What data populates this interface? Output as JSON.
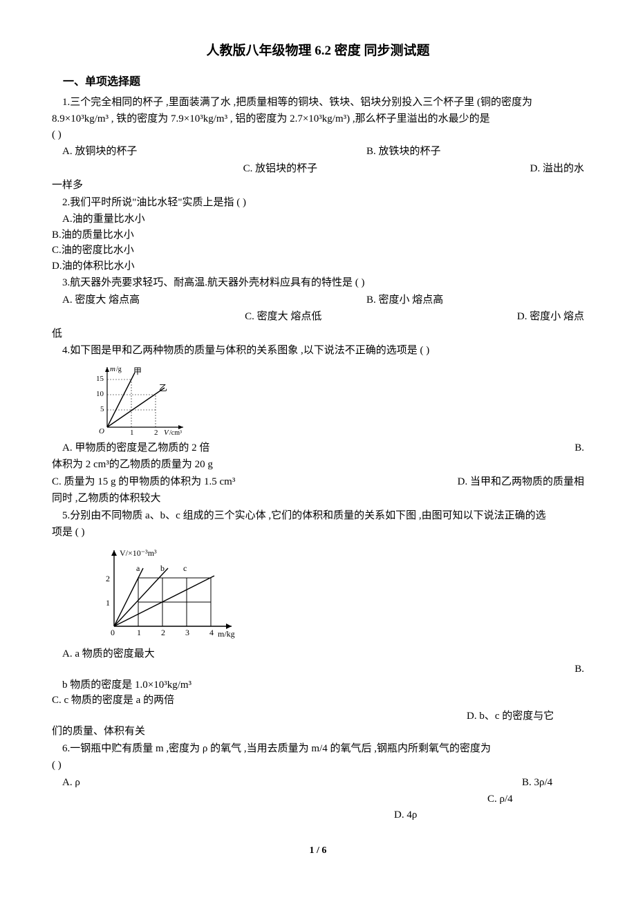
{
  "title": "人教版八年级物理 6.2 密度 同步测试题",
  "section1": "一、单项选择题",
  "q1": {
    "text": "1.三个完全相同的杯子 ,里面装满了水 ,把质量相等的铜块、铁块、铝块分别投入三个杯子里 (铜的密度为",
    "text2": "8.9×10³kg/m³   , 铁的密度为 7.9×10³kg/m³   , 铝的密度为 2.7×10³kg/m³)  ,那么杯子里溢出的水最少的是",
    "text3": "(     )",
    "a": "A.  放铜块的杯子",
    "b": "B.  放铁块的杯子",
    "c": "C.  放铝块的杯子",
    "d": "D.  溢出的水",
    "dext": "一样多"
  },
  "q2": {
    "text": "2.我们平时所说\"油比水轻\"实质上是指 (      )",
    "a": "A.油的重量比水小",
    "b": "B.油的质量比水小",
    "c": "C.油的密度比水小",
    "d": "D.油的体积比水小"
  },
  "q3": {
    "text": "3.航天器外壳要求轻巧、耐高温.航天器外壳材料应具有的特性是 (     )",
    "a": "A.  密度大   熔点高",
    "b": "B.  密度小   熔点高",
    "c": "C.  密度大   熔点低",
    "d": "D.  密度小   熔点",
    "dext": "低"
  },
  "q4": {
    "text": "4.如下图是甲和乙两种物质的质量与体积的关系图象 ,以下说法不正确的选项是 (       )",
    "a": "A.  甲物质的密度是乙物质的 2 倍",
    "b": "B.",
    "bext": "体积为 2 cm³的乙物质的质量为 20 g",
    "c": "C.  质量为 15 g 的甲物质的体积为 1.5 cm³",
    "d": "D.  当甲和乙两物质的质量相",
    "dext": "同时 ,乙物质的体积较大"
  },
  "q5": {
    "text": "5.分别由不同物质 a、b、c 组成的三个实心体 ,它们的体积和质量的关系如下图 ,由图可知以下说法正确的选",
    "text2": "项是 (    )",
    "a": "A.  a 物质的密度最大",
    "b": "B.",
    "bext": "b 物质的密度是 1.0×10³kg/m³",
    "c": "C.  c 物质的密度是 a 的两倍",
    "d": "D.  b、c 的密度与它",
    "dext": "们的质量、体积有关"
  },
  "q6": {
    "text": "6.一钢瓶中贮有质量 m ,密度为 ρ 的氧气 ,当用去质量为 m/4 的氧气后 ,钢瓶内所剩氧气的密度为",
    "text2": "(        )",
    "a": "A.   ρ",
    "b": "B.  3ρ/4",
    "c": "C.   ρ/4",
    "d": "D.  4ρ"
  },
  "footer": "1 / 6",
  "chart_data": [
    {
      "type": "line",
      "title": "Q4 质量-体积图象",
      "xlabel": "V/cm³",
      "ylabel": "m/g",
      "xlim": [
        0,
        2.2
      ],
      "ylim": [
        0,
        17
      ],
      "yticks": [
        5,
        10,
        15
      ],
      "xticks": [
        1,
        2
      ],
      "series": [
        {
          "name": "甲",
          "x": [
            0,
            1
          ],
          "y": [
            0,
            15
          ]
        },
        {
          "name": "乙",
          "x": [
            0,
            2
          ],
          "y": [
            0,
            10
          ]
        }
      ]
    },
    {
      "type": "line",
      "title": "Q5 体积-质量图象",
      "xlabel": "m/kg",
      "ylabel": "V/×10⁻³m³",
      "xlim": [
        0,
        4.2
      ],
      "ylim": [
        0,
        2.5
      ],
      "yticks": [
        1,
        2
      ],
      "xticks": [
        1,
        2,
        3,
        4
      ],
      "series": [
        {
          "name": "a",
          "x": [
            0,
            1
          ],
          "y": [
            0,
            2
          ]
        },
        {
          "name": "b",
          "x": [
            0,
            2
          ],
          "y": [
            0,
            2
          ]
        },
        {
          "name": "c",
          "x": [
            0,
            4
          ],
          "y": [
            0,
            2
          ]
        }
      ]
    }
  ]
}
